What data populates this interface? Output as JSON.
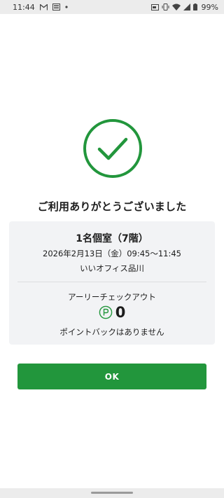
{
  "status_bar": {
    "time": "11:44",
    "battery": "99%",
    "left_icons": [
      "gmail-icon",
      "image-icon",
      "dot-icon"
    ],
    "right_icons": [
      "cast-icon",
      "vibrate-icon",
      "wifi-icon",
      "signal-icon",
      "battery-icon"
    ]
  },
  "success": {
    "icon": "checkmark-circle-icon",
    "color": "#22963c",
    "message": "ご利用ありがとうございました"
  },
  "reservation": {
    "room": "1名個室（7階）",
    "datetime": "2026年2月13日（金）09:45〜11:45",
    "location": "いいオフィス品川"
  },
  "checkout": {
    "label": "アーリーチェックアウト",
    "point_icon": "point-icon",
    "points": "0",
    "message": "ポイントバックはありません"
  },
  "actions": {
    "ok_label": "OK",
    "ok_color": "#22963c"
  }
}
